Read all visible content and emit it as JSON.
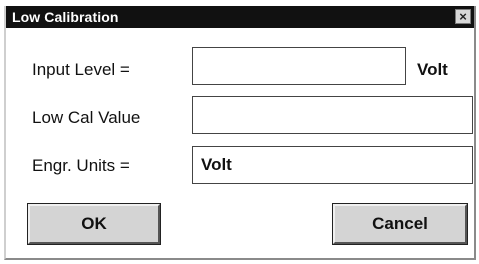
{
  "window": {
    "title": "Low Calibration",
    "close_glyph": "×"
  },
  "form": {
    "input_level_label": "Input Level =",
    "input_level_value": "",
    "input_level_unit": "Volt",
    "low_cal_label": "Low Cal Value",
    "low_cal_value": "",
    "engr_units_label": "Engr. Units =",
    "engr_units_value": "Volt"
  },
  "buttons": {
    "ok": "OK",
    "cancel": "Cancel"
  }
}
